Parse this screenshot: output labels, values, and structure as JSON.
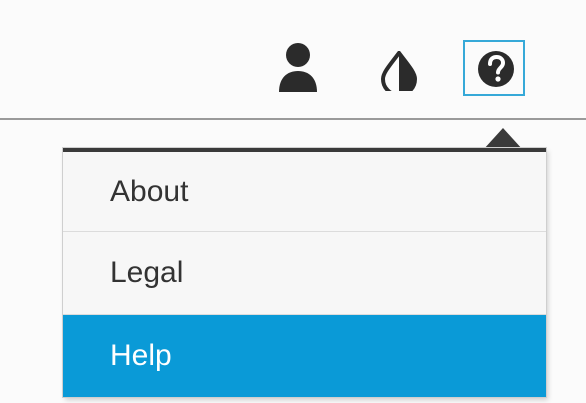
{
  "topbar": {
    "icons": [
      "user-icon",
      "contrast-icon",
      "help-icon"
    ],
    "active_icon": "help-icon"
  },
  "menu": {
    "items": [
      {
        "label": "About"
      },
      {
        "label": "Legal"
      },
      {
        "label": "Help"
      }
    ],
    "selected_index": 2
  },
  "colors": {
    "accent": "#0a9ad7",
    "focus_border": "#36a9d8",
    "icon": "#2b2b2b",
    "menu_text": "#333333"
  }
}
